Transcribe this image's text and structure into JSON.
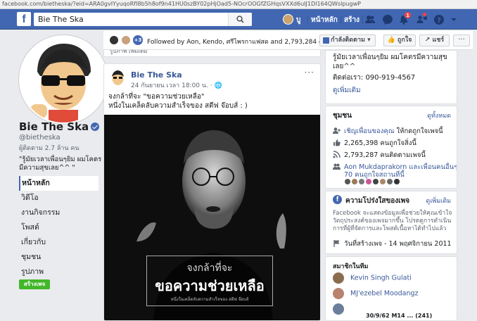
{
  "browser": {
    "url": "facebook.com/bietheska/?eid=ARA0gvIYyuqoRfI8b5h8of9n41HU0szBY02pHjOad5-NOcrOOGfZGHqsVXXd6uIJ1DI164QWslpugwP"
  },
  "header": {
    "search_value": "Bie The Ska",
    "user_name": "บู",
    "home_label": "หน้าหลัก",
    "create_label": "สร้าง",
    "notif_count": "1"
  },
  "profile": {
    "name": "Bie The Ska",
    "handle": "@bietheska",
    "followers": "ผู้ติดตาม 2.7 ล้าน คน",
    "bio": "\"รู้มัยเวลาเพื่อนๆยิม ผมโคตรมีความสุขเลย^^ \""
  },
  "nav": {
    "items": [
      {
        "label": "หน้าหลัก"
      },
      {
        "label": "วิดีโอ"
      },
      {
        "label": "งานกิจกรรม"
      },
      {
        "label": "โพสต์"
      },
      {
        "label": "เกี่ยวกับ"
      },
      {
        "label": "ชุมชน"
      },
      {
        "label": "รูปภาพ"
      }
    ],
    "create_page": "สร้างเพจ"
  },
  "actionbar": {
    "plus_count": "+3",
    "followed_by": "Followed by Aon, Kendo, ศรีไพรกาแฟสด and 2,793,284 others",
    "following": "กำลังติดตาม",
    "like": "ถูกใจ",
    "share": "แชร์",
    "more": "···"
  },
  "post": {
    "top_snippet": "รูปภาพ เพิ่มเติม",
    "author": "Bie The Ska",
    "time": "24 กันยายน เวลา 18:00 น. · 🌐",
    "text_line1": "จงกล้าที่จะ \"ขอความช่วยเหลือ\"",
    "text_line2": "หนึ่งในเคล็ดลับความสำเร็จของ สตีฟ จ๊อบส์ : )",
    "caption_small": "จงกล้าที่จะ",
    "caption_big": "ขอความช่วยเหลือ",
    "caption_tiny": "หนึ่งในเคล็ดลับความสำเร็จของ สตีฟ จ๊อบส์"
  },
  "about": {
    "line1": "รู้มัยเวลาเพื่อนๆยิม ผมโคตรมีความสุข",
    "line2": "เลย^^",
    "contact": "ติดต่อเรา: 090-919-4567",
    "see_more": "ดูเพิ่มเติม"
  },
  "community": {
    "title": "ชุมชน",
    "see_all": "ดูทั้งหมด",
    "invite": "เชิญเพื่อนของคุณ",
    "invite_suffix": "ให้กดถูกใจเพจนี้",
    "likes": "2,265,398 คนถูกใจสิ่งนี้",
    "follows": "2,793,287 คนติดตามเพจนี้",
    "friends_line1": "Aon Mukdaprakorn และเพื่อนคนอื่นๆ อีก",
    "friends_line2": "70 คนถูกใจสถานที่นี้"
  },
  "transparency": {
    "title": "ความโปร่งใสของเพจ",
    "see_more": "ดูเพิ่มเติม",
    "text": "Facebook จะแสดงข้อมูลเพื่อช่วยให้คุณเข้าใจวัตถุประสงค์ของเพจมากขึ้น โปรดดูการดำเนินการที่ผู้ที่จัดการและโพสต์เนื้อหาได้ทำไปแล้ว",
    "created": "วันที่สร้างเพจ - 14 พฤศจิกายน 2011"
  },
  "members": {
    "title": "สมาชิกในทีม",
    "items": [
      {
        "name": "Kevin Singh Gulati",
        "color": "#8a6d4f"
      },
      {
        "name": "MJ'ezebel Moodangz",
        "color": "#b9826e"
      },
      {
        "name": "",
        "color": "#6b7f9b"
      }
    ]
  },
  "bottom_snippet": "30/9/62 M14 ... (241)",
  "colors": {
    "fb_blue": "#4267b2",
    "link": "#385898",
    "green": "#42b72a",
    "badge": "#fa3e3e"
  }
}
